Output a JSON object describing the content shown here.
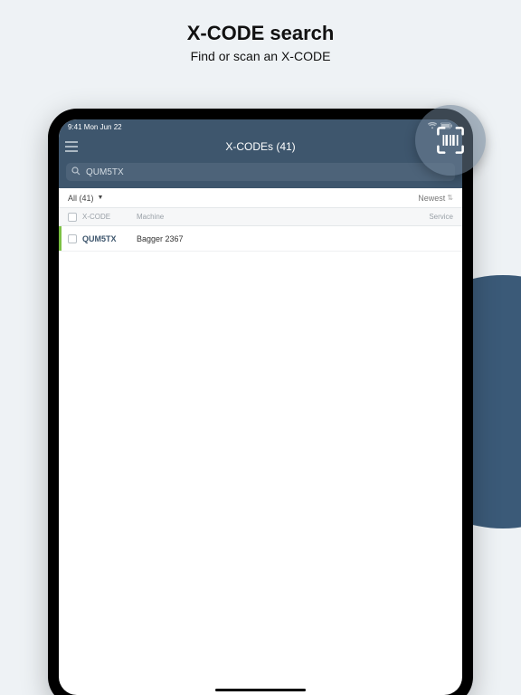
{
  "promo": {
    "title": "X-CODE search",
    "subtitle": "Find or scan an X-CODE"
  },
  "status": {
    "time": "9:41 Mon Jun 22",
    "wifi": "wifi",
    "battery": "100%"
  },
  "header": {
    "menu_icon": "menu",
    "title": "X-CODEs (41)"
  },
  "search": {
    "icon": "search",
    "value": "QUM5TX"
  },
  "filter": {
    "label": "All (41)",
    "sort_label": "Newest"
  },
  "table": {
    "columns": {
      "xcode": "X-CODE",
      "machine": "Machine",
      "service": "Service"
    },
    "rows": [
      {
        "xcode": "QUM5TX",
        "machine": "Bagger 2367"
      }
    ]
  },
  "scan_button": {
    "name": "scan-barcode"
  }
}
